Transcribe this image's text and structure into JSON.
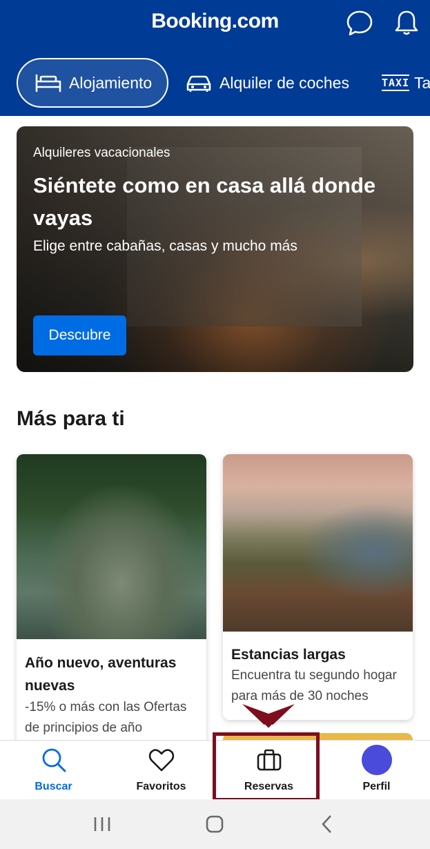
{
  "header": {
    "brand": "Booking.com",
    "icons": [
      "chat-bubble-icon",
      "bell-icon"
    ],
    "tabs": [
      {
        "label": "Alojamiento",
        "icon": "bed-icon",
        "active": true
      },
      {
        "label": "Alquiler de coches",
        "icon": "car-icon",
        "active": false
      },
      {
        "label": "Ta",
        "icon": "taxi-icon",
        "icon_text": "TAXI",
        "active": false
      }
    ]
  },
  "hero": {
    "eyebrow": "Alquileres vacacionales",
    "title": "Siéntete como en casa allá donde vayas",
    "subtitle": "Elige entre cabañas, casas y mucho más",
    "button": "Descubre"
  },
  "section": {
    "title": "Más para ti",
    "cards": [
      {
        "title": "Año nuevo, aventuras nuevas",
        "subtitle": "-15% o más con las Ofertas de principios de año"
      },
      {
        "title": "Estancias largas",
        "subtitle": "Encuentra tu segundo hogar para más de 30 noches"
      }
    ]
  },
  "bottom_nav": {
    "items": [
      {
        "label": "Buscar",
        "icon": "search-icon",
        "active": true
      },
      {
        "label": "Favoritos",
        "icon": "heart-icon",
        "active": false
      },
      {
        "label": "Reservas",
        "icon": "briefcase-icon",
        "active": false,
        "highlighted": true
      },
      {
        "label": "Perfil",
        "icon": "avatar",
        "active": false
      }
    ]
  },
  "system_nav": [
    "recents-icon",
    "home-icon",
    "back-icon"
  ],
  "colors": {
    "brand_blue": "#003b95",
    "action_blue": "#006ce4",
    "highlight_border": "#7e0d1e"
  }
}
